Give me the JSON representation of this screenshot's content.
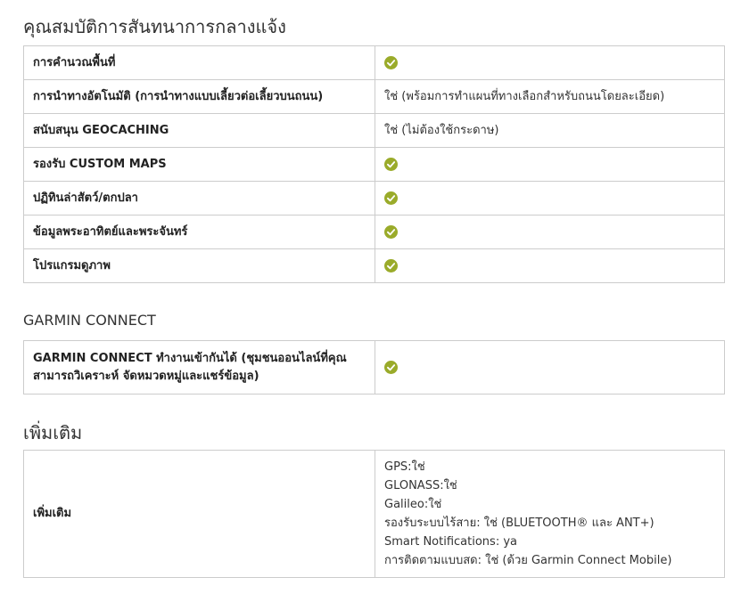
{
  "colors": {
    "check": "#9aab2a",
    "border": "#cccccc",
    "text": "#222222"
  },
  "sections": {
    "features": {
      "title": "คุณสมบัติการสันทนาการกลางแจ้ง",
      "rows": [
        {
          "label": "การคำนวณพื้นที่",
          "value": "",
          "check": true
        },
        {
          "label": "การนำทางอัตโนมัติ (การนำทางแบบเลี้ยวต่อเลี้ยวบนถนน)",
          "value": "ใช่ (พร้อมการทำแผนที่ทางเลือกสำหรับถนนโดยละเอียด)",
          "check": false
        },
        {
          "label": "สนับสนุน GEOCACHING",
          "value": "ใช่ (ไม่ต้องใช้กระดาษ)",
          "check": false
        },
        {
          "label": "รองรับ CUSTOM MAPS",
          "value": "",
          "check": true
        },
        {
          "label": "ปฏิทินล่าสัตว์/ตกปลา",
          "value": "",
          "check": true
        },
        {
          "label": "ข้อมูลพระอาทิตย์และพระจันทร์",
          "value": "",
          "check": true
        },
        {
          "label": "โปรแกรมดูภาพ",
          "value": "",
          "check": true
        }
      ]
    },
    "connect": {
      "title": "GARMIN CONNECT",
      "rows": [
        {
          "label": "GARMIN CONNECT ทำงานเข้ากันได้ (ชุมชนออนไลน์ที่คุณสามารถวิเคราะห์ จัดหมวดหมู่และแชร์ข้อมูล)",
          "value": "",
          "check": true
        }
      ]
    },
    "extra": {
      "title": "เพิ่มเติม",
      "rows": [
        {
          "label": "เพิ่มเติม",
          "lines": [
            "GPS:ใช่",
            "GLONASS:ใช่",
            "Galileo:ใช่",
            "รองรับระบบไร้สาย: ใช่ (BLUETOOTH® และ ANT+)",
            "Smart Notifications: ya",
            "การติดตามแบบสด: ใช่ (ด้วย Garmin Connect Mobile)"
          ]
        }
      ]
    }
  }
}
